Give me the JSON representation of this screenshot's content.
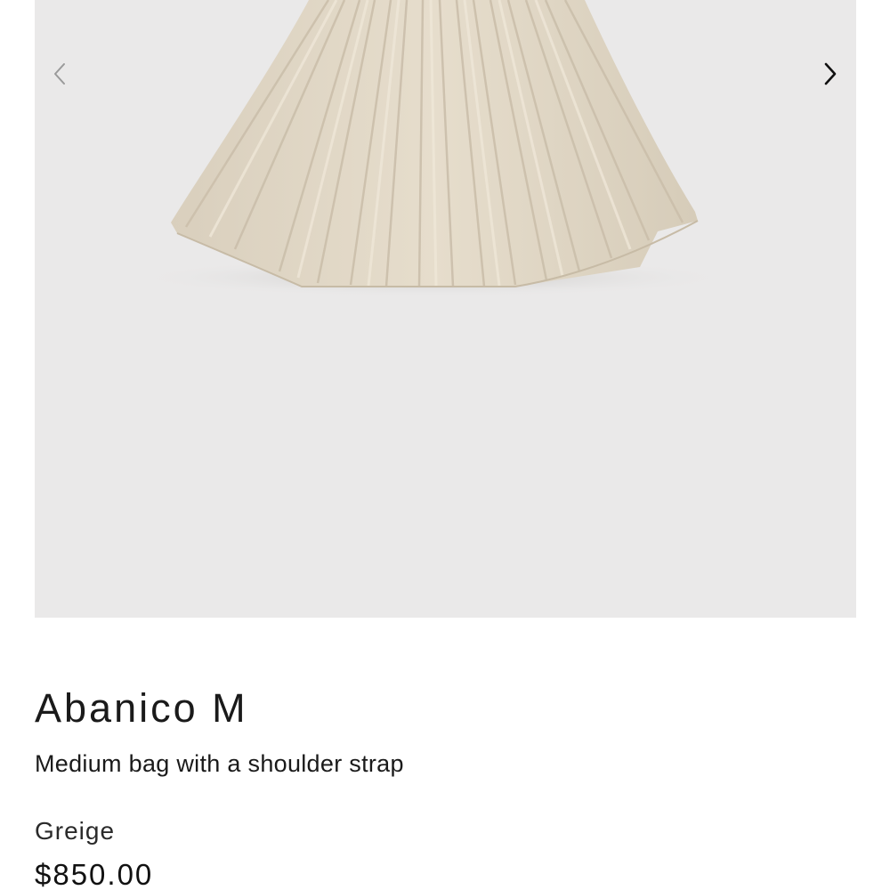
{
  "gallery": {
    "image_alt": "Abanico M pleated bag in Greige",
    "prev_icon": "chevron-left-icon",
    "next_icon": "chevron-right-icon"
  },
  "product": {
    "title": "Abanico M",
    "subtitle": "Medium bag with a shoulder strap",
    "color": "Greige",
    "price": "$850.00"
  },
  "colors": {
    "gallery_background": "#eae9e9",
    "bag": "#e2d8c6",
    "text": "#1a1a1a"
  }
}
